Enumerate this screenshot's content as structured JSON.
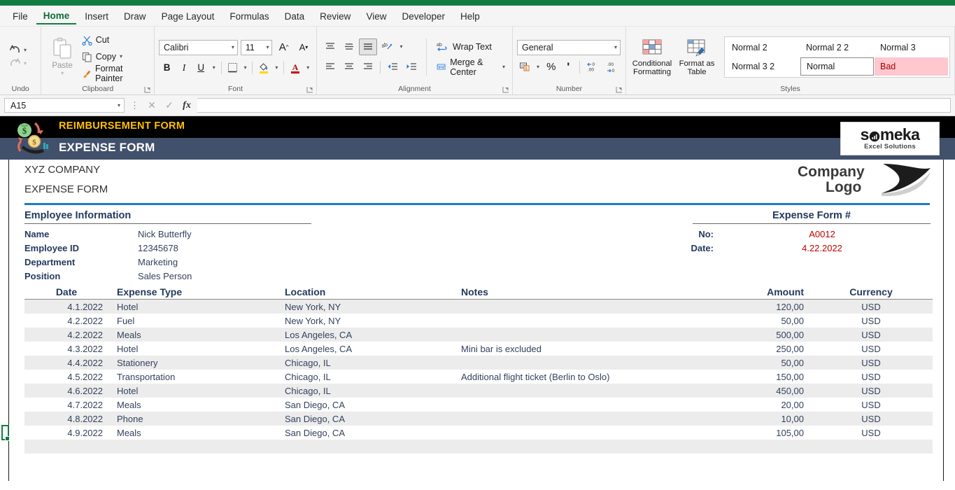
{
  "app": {
    "accent_green": "#107c41",
    "namebox_value": "A15",
    "formula_value": ""
  },
  "tabs": [
    {
      "label": "File",
      "active": false
    },
    {
      "label": "Home",
      "active": true
    },
    {
      "label": "Insert",
      "active": false
    },
    {
      "label": "Draw",
      "active": false
    },
    {
      "label": "Page Layout",
      "active": false
    },
    {
      "label": "Formulas",
      "active": false
    },
    {
      "label": "Data",
      "active": false
    },
    {
      "label": "Review",
      "active": false
    },
    {
      "label": "View",
      "active": false
    },
    {
      "label": "Developer",
      "active": false
    },
    {
      "label": "Help",
      "active": false
    }
  ],
  "ribbon": {
    "undo": {
      "group_label": "Undo",
      "undo_icon": "undo-arrow-icon",
      "redo_icon": "redo-arrow-icon"
    },
    "clipboard": {
      "group_label": "Clipboard",
      "paste_label": "Paste",
      "cut_label": "Cut",
      "copy_label": "Copy",
      "format_painter_label": "Format Painter"
    },
    "font": {
      "group_label": "Font",
      "font_name": "Calibri",
      "font_size": "11",
      "grow_label": "A",
      "shrink_label": "A",
      "bold_label": "B",
      "italic_label": "I",
      "underline_label": "U"
    },
    "alignment": {
      "group_label": "Alignment",
      "wrap_text_label": "Wrap Text",
      "merge_center_label": "Merge & Center"
    },
    "number": {
      "group_label": "Number",
      "format_value": "General",
      "percent_label": "%",
      "comma_label": "'"
    },
    "styles": {
      "group_label": "Styles",
      "conditional_formatting_label": "Conditional Formatting",
      "format_as_table_label": "Format as Table",
      "gallery": [
        {
          "label": "Normal 2",
          "state": "normal"
        },
        {
          "label": "Normal 2 2",
          "state": "normal"
        },
        {
          "label": "Normal 3",
          "state": "normal"
        },
        {
          "label": "Normal 3 2",
          "state": "normal"
        },
        {
          "label": "Normal",
          "state": "selected"
        },
        {
          "label": "Bad",
          "state": "bad"
        }
      ]
    }
  },
  "banner": {
    "subtitle": "REIMBURSEMENT FORM",
    "title": "EXPENSE FORM",
    "brand_name": "someka",
    "brand_tagline": "Excel Solutions"
  },
  "form": {
    "company_name": "XYZ COMPANY",
    "form_name": "EXPENSE FORM",
    "logo_line1": "Company",
    "logo_line2": "Logo",
    "employee_section_title": "Employee Information",
    "employee_fields": [
      {
        "label": "Name",
        "value": "Nick Butterfly"
      },
      {
        "label": "Employee ID",
        "value": "12345678"
      },
      {
        "label": "Department",
        "value": "Marketing"
      },
      {
        "label": "Position",
        "value": "Sales Person"
      }
    ],
    "expense_form_title": "Expense Form #",
    "expense_form_fields": [
      {
        "label": "No:",
        "value": "A0012"
      },
      {
        "label": "Date:",
        "value": "4.22.2022"
      }
    ]
  },
  "table": {
    "columns": [
      "Date",
      "Expense Type",
      "Location",
      "Notes",
      "Amount",
      "Currency"
    ],
    "rows": [
      {
        "date": "4.1.2022",
        "type": "Hotel",
        "location": "New York, NY",
        "notes": "",
        "amount": "120,00",
        "currency": "USD"
      },
      {
        "date": "4.2.2022",
        "type": "Fuel",
        "location": "New York, NY",
        "notes": "",
        "amount": "50,00",
        "currency": "USD"
      },
      {
        "date": "4.2.2022",
        "type": "Meals",
        "location": "Los Angeles, CA",
        "notes": "",
        "amount": "500,00",
        "currency": "USD"
      },
      {
        "date": "4.3.2022",
        "type": "Hotel",
        "location": "Los Angeles, CA",
        "notes": "Mini bar is excluded",
        "amount": "250,00",
        "currency": "USD"
      },
      {
        "date": "4.4.2022",
        "type": "Stationery",
        "location": "Chicago, IL",
        "notes": "",
        "amount": "50,00",
        "currency": "USD"
      },
      {
        "date": "4.5.2022",
        "type": "Transportation",
        "location": "Chicago, IL",
        "notes": "Additional flight ticket (Berlin to Oslo)",
        "amount": "150,00",
        "currency": "USD"
      },
      {
        "date": "4.6.2022",
        "type": "Hotel",
        "location": "Chicago, IL",
        "notes": "",
        "amount": "450,00",
        "currency": "USD"
      },
      {
        "date": "4.7.2022",
        "type": "Meals",
        "location": "San Diego, CA",
        "notes": "",
        "amount": "20,00",
        "currency": "USD"
      },
      {
        "date": "4.8.2022",
        "type": "Phone",
        "location": "San Diego, CA",
        "notes": "",
        "amount": "10,00",
        "currency": "USD"
      },
      {
        "date": "4.9.2022",
        "type": "Meals",
        "location": "San Diego, CA",
        "notes": "",
        "amount": "105,00",
        "currency": "USD"
      },
      {
        "date": "",
        "type": "",
        "location": "",
        "notes": "",
        "amount": "",
        "currency": ""
      }
    ]
  }
}
